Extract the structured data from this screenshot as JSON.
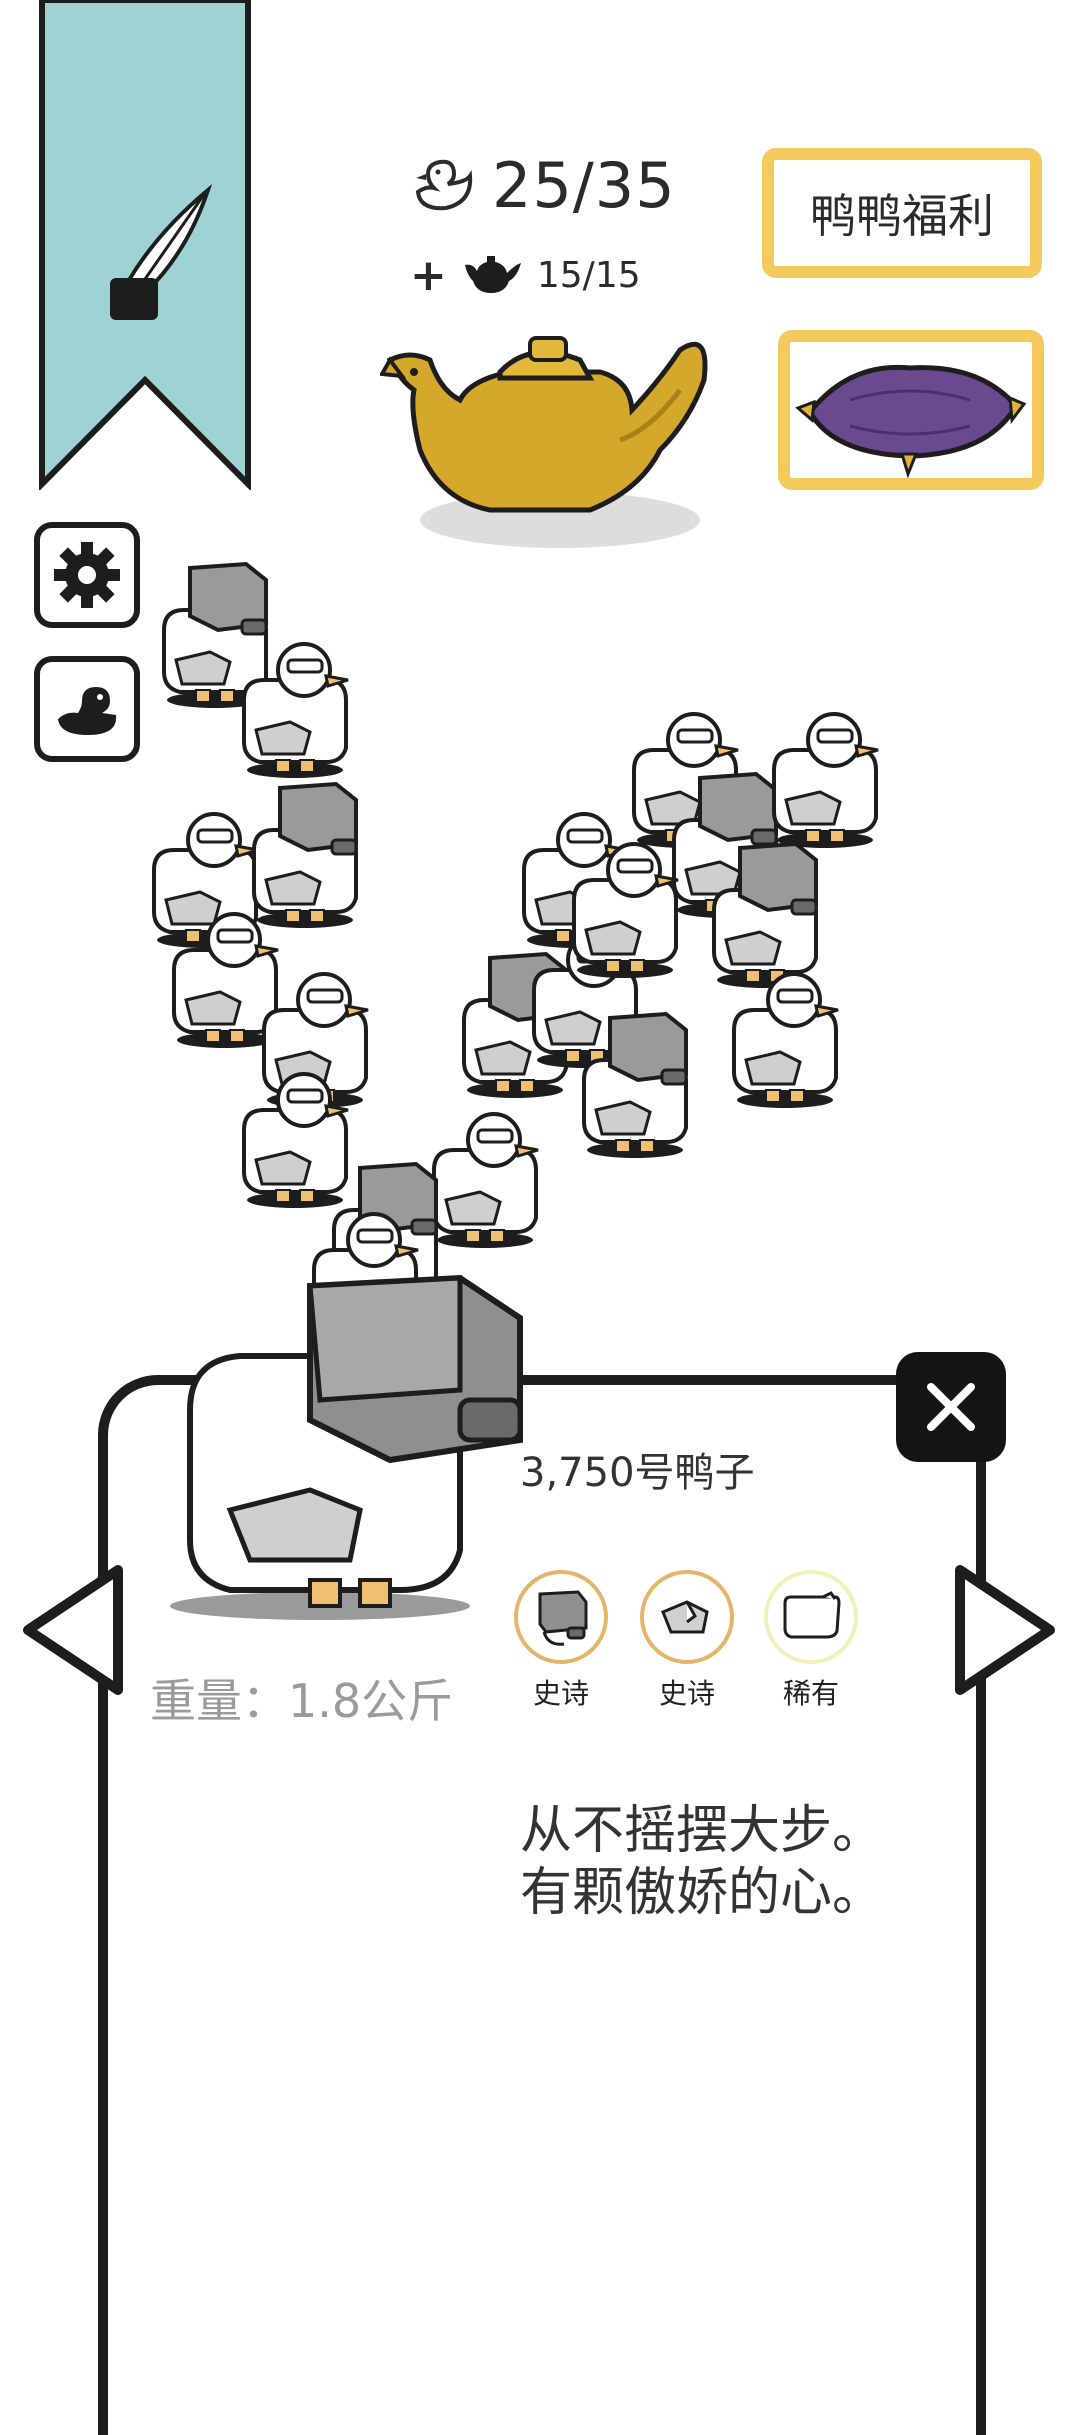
{
  "header": {
    "duck_count": "25/35",
    "teapot_prefix": "+",
    "teapot_count": "15/15",
    "welfare_button": "鸭鸭福利"
  },
  "colors": {
    "banner": "#9fd3d3",
    "gold_border": "#f4c95d",
    "cushion": "#6a4a8e",
    "teapot": "#d4a82a"
  },
  "icons": {
    "banner": "quill-inkpot-icon",
    "settings": "gear-icon",
    "ducks": "duck-silhouette-icon",
    "close": "close-icon",
    "prev": "arrow-left-icon",
    "next": "arrow-right-icon"
  },
  "card": {
    "title": "3,750号鸭子",
    "weight": "重量：1.8公斤",
    "parts": [
      {
        "rarity": "史诗",
        "icon": "box-head-icon"
      },
      {
        "rarity": "史诗",
        "icon": "wing-icon"
      },
      {
        "rarity": "稀有",
        "icon": "body-icon"
      }
    ],
    "description_line1": "从不摇摆大步。",
    "description_line2": "有颗傲娇的心。"
  }
}
